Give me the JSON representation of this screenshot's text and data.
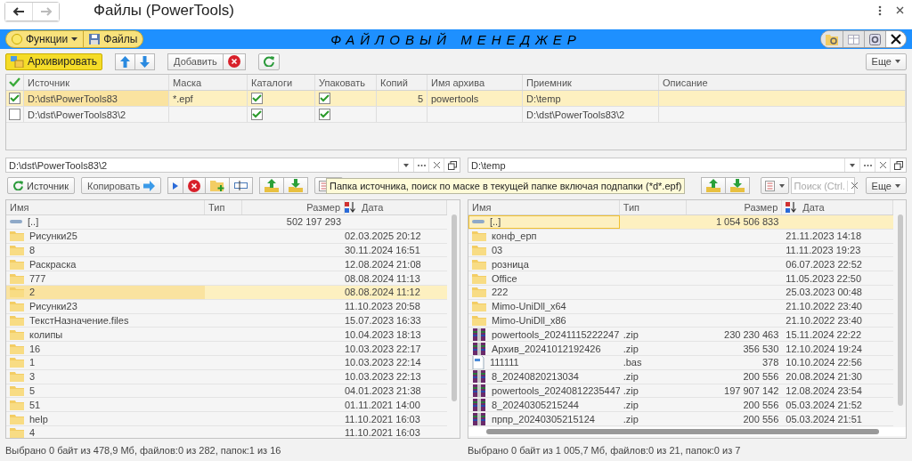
{
  "window": {
    "title": "Файлы (PowerTools)",
    "back": {
      "disabled": false
    },
    "forward": {
      "disabled": true
    }
  },
  "header": {
    "menu_buttons": [
      {
        "kind": "dropdown",
        "label": "Функции"
      },
      {
        "kind": "save",
        "label": "Файлы"
      }
    ],
    "title": "ФАЙЛОВЫЙ МЕНЕДЖЕР"
  },
  "toolbar": {
    "archive": "Архивировать",
    "add": "Добавить",
    "more": "Еще"
  },
  "tasks": {
    "columns": [
      "Источник",
      "Маска",
      "Каталоги",
      "Упаковать",
      "Копий",
      "Имя архива",
      "Приемник",
      "Описание"
    ],
    "rows": [
      {
        "checked": true,
        "selected": true,
        "source": "D:\\dst\\PowerTools83",
        "mask": "*.epf",
        "catalogs": true,
        "pack": true,
        "copies": "5",
        "archive_name": "powertools",
        "target": "D:\\temp"
      },
      {
        "checked": false,
        "selected": false,
        "source": "D:\\dst\\PowerTools83\\2",
        "catalogs": true,
        "pack": true,
        "target": "D:\\dst\\PowerTools83\\2"
      }
    ]
  },
  "tooltip": "Папка источника, поиск по маске в текущей папке включая подпапки (*d*.epf)",
  "panes": [
    {
      "path": "D:\\dst\\PowerTools83\\2",
      "source_button": "Источник",
      "copy_button": "Копировать",
      "columns": [
        "Имя",
        "Тип",
        "Размер",
        "Дата"
      ],
      "hscroll": false,
      "rows": [
        {
          "kind": "up",
          "selected": false,
          "name": "[..]",
          "size": "502 197 293"
        },
        {
          "kind": "folder",
          "selected": false,
          "name": "Рисунки25",
          "date": "02.03.2025 20:12"
        },
        {
          "kind": "folder",
          "selected": false,
          "name": "8",
          "date": "30.11.2024 16:51"
        },
        {
          "kind": "folder",
          "selected": false,
          "name": "Раскраска",
          "date": "12.08.2024 21:08"
        },
        {
          "kind": "folder",
          "selected": false,
          "name": "777",
          "date": "08.08.2024 11:13"
        },
        {
          "kind": "folder",
          "selected": true,
          "name": "2",
          "date": "08.08.2024 11:12"
        },
        {
          "kind": "folder",
          "selected": false,
          "name": "Рисунки23",
          "date": "11.10.2023 20:58"
        },
        {
          "kind": "folder",
          "selected": false,
          "name": "ТекстНазначение.files",
          "date": "15.07.2023 16:33"
        },
        {
          "kind": "folder",
          "selected": false,
          "name": "колипы",
          "date": "10.04.2023 18:13"
        },
        {
          "kind": "folder",
          "selected": false,
          "name": "16",
          "date": "10.03.2023 22:17"
        },
        {
          "kind": "folder",
          "selected": false,
          "name": "1",
          "date": "10.03.2023 22:14"
        },
        {
          "kind": "folder",
          "selected": false,
          "name": "3",
          "date": "10.03.2023 22:13"
        },
        {
          "kind": "folder",
          "selected": false,
          "name": "5",
          "date": "04.01.2023 21:38"
        },
        {
          "kind": "folder",
          "selected": false,
          "name": "51",
          "date": "01.11.2021 14:00"
        },
        {
          "kind": "folder",
          "selected": false,
          "name": "help",
          "date": "11.10.2021 16:03"
        },
        {
          "kind": "folder",
          "selected": false,
          "name": "4",
          "date": "11.10.2021 16:03"
        }
      ],
      "status": "Выбрано 0 байт из 478,9 Мб, файлов:0 из 282, папок:1 из 16"
    },
    {
      "path": "D:\\temp",
      "search_placeholder": "Поиск (Ctrl.",
      "more": "Еще",
      "columns": [
        "Имя",
        "Тип",
        "Размер",
        "Дата"
      ],
      "hscroll": true,
      "rows": [
        {
          "kind": "up",
          "selected": true,
          "name": "[..]",
          "size": "1 054 506 833"
        },
        {
          "kind": "folder",
          "selected": false,
          "name": "конф_ерп",
          "date": "21.11.2023 14:18"
        },
        {
          "kind": "folder",
          "selected": false,
          "name": "03",
          "date": "11.11.2023 19:23"
        },
        {
          "kind": "folder",
          "selected": false,
          "name": "розница",
          "date": "06.07.2023 22:52"
        },
        {
          "kind": "folder",
          "selected": false,
          "name": "Office",
          "date": "11.05.2023 22:50"
        },
        {
          "kind": "folder",
          "selected": false,
          "name": "222",
          "date": "25.03.2023 00:48"
        },
        {
          "kind": "folder",
          "selected": false,
          "name": "Mimo-UniDll_x64",
          "date": "21.10.2022 23:40"
        },
        {
          "kind": "folder",
          "selected": false,
          "name": "Mimo-UniDll_x86",
          "date": "21.10.2022 23:40"
        },
        {
          "kind": "zip",
          "selected": false,
          "name": "powertools_20241115222247",
          "type": ".zip",
          "size": "230 230 463",
          "date": "15.11.2024 22:22"
        },
        {
          "kind": "zip",
          "selected": false,
          "name": "Архив_20241012192426",
          "type": ".zip",
          "size": "356 530",
          "date": "12.10.2024 19:24"
        },
        {
          "kind": "file",
          "selected": false,
          "name": "111111",
          "type": ".bas",
          "size": "378",
          "date": "10.10.2024 22:56"
        },
        {
          "kind": "zip",
          "selected": false,
          "name": "8_20240820213034",
          "type": ".zip",
          "size": "200 556",
          "date": "20.08.2024 21:30"
        },
        {
          "kind": "zip",
          "selected": false,
          "name": "powertools_20240812235447",
          "type": ".zip",
          "size": "197 907 142",
          "date": "12.08.2024 23:54"
        },
        {
          "kind": "zip",
          "selected": false,
          "name": "8_20240305215244",
          "type": ".zip",
          "size": "200 556",
          "date": "05.03.2024 21:52"
        },
        {
          "kind": "zip",
          "selected": false,
          "name": "прпр_20240305215124",
          "type": ".zip",
          "size": "200 556",
          "date": "05.03.2024 21:51"
        }
      ],
      "status": "Выбрано 0 байт из 1 005,7 Мб, файлов:0 из 21, папок:0 из 7"
    }
  ]
}
